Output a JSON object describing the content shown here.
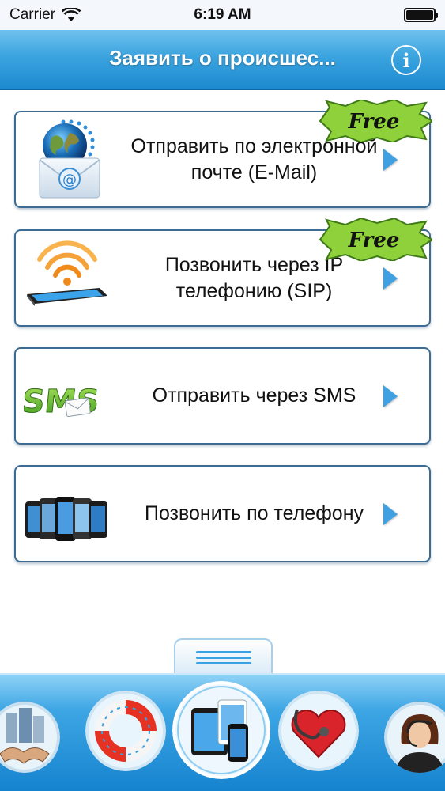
{
  "status_bar": {
    "carrier": "Carrier",
    "time": "6:19 AM"
  },
  "nav": {
    "title": "Заявить о происшес...",
    "info_label": "i"
  },
  "free_badge": "Free",
  "cards": [
    {
      "label": "Отправить по электронной почте (E-Mail)",
      "icon": "email-globe-icon",
      "free": true
    },
    {
      "label": "Позвонить через IP телефонию (SIP)",
      "icon": "wifi-tablet-icon",
      "free": true
    },
    {
      "label": "Отправить через SMS",
      "icon": "sms-icon",
      "free": false
    },
    {
      "label": "Позвонить по телефону",
      "icon": "smartphones-icon",
      "free": false
    }
  ],
  "dock": [
    {
      "icon": "business-handshake-icon"
    },
    {
      "icon": "lifebuoy-icon"
    },
    {
      "icon": "devices-icon"
    },
    {
      "icon": "heart-stethoscope-icon"
    },
    {
      "icon": "support-operator-icon"
    }
  ],
  "colors": {
    "accent": "#3ba4df",
    "card_border": "#3c6c94",
    "free_green": "#8fd13a"
  }
}
